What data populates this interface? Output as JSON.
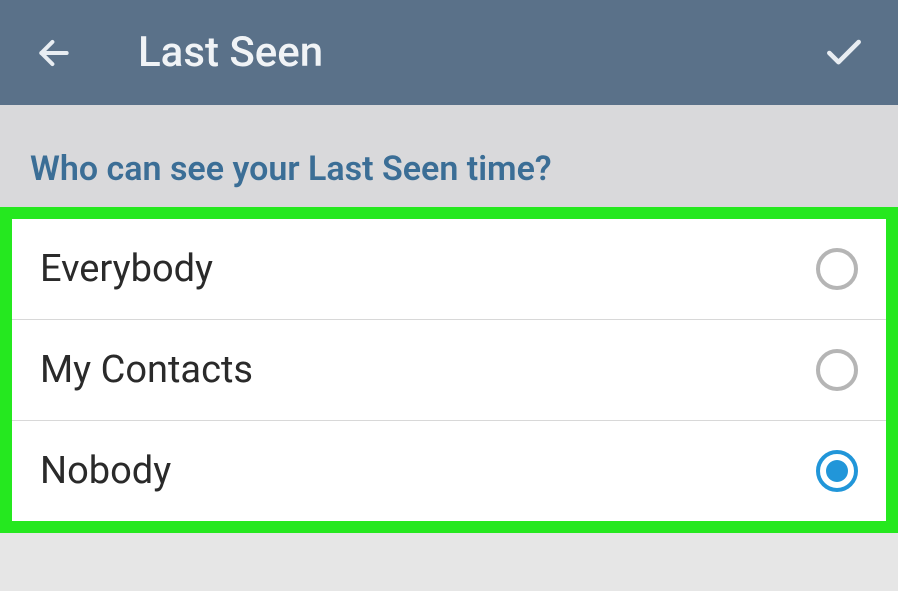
{
  "header": {
    "title": "Last Seen"
  },
  "section": {
    "title": "Who can see your Last Seen time?"
  },
  "options": [
    {
      "label": "Everybody",
      "selected": false
    },
    {
      "label": "My Contacts",
      "selected": false
    },
    {
      "label": "Nobody",
      "selected": true
    }
  ]
}
